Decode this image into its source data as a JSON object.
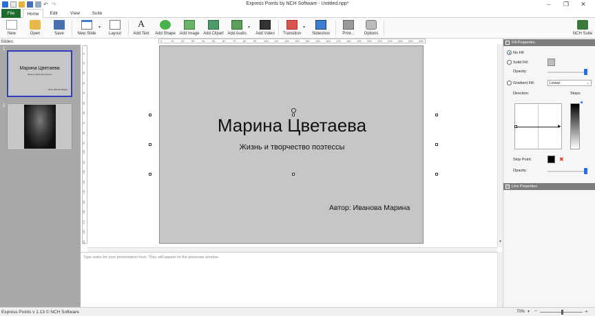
{
  "window": {
    "title": "Express Points by NCH Software - Untitled.npp*"
  },
  "menu_tabs": [
    "File",
    "Home",
    "Edit",
    "View",
    "Suite"
  ],
  "toolbar": {
    "new": "New",
    "open": "Open",
    "save": "Save",
    "new_slide": "New Slide",
    "layout": "Layout",
    "add_text": "Add Text",
    "add_shape": "Add Shape",
    "add_image": "Add Image",
    "add_clipart": "Add Clipart",
    "add_audio": "Add Audio",
    "add_video": "Add Video",
    "transition": "Transition",
    "slideshow": "Slideshov",
    "print": "Print...",
    "options": "Options",
    "nch_suite": "NCH Suite"
  },
  "slides_panel": {
    "label": "Slides:",
    "thumbnails": [
      {
        "number": "1",
        "title": "Марина Цветаева",
        "subtitle": "Жизнь и творчество поэтессы",
        "author": "Автор: Иванова Марина"
      },
      {
        "number": "2"
      }
    ]
  },
  "ruler": {
    "top": [
      "0",
      "10",
      "20",
      "30",
      "40",
      "50",
      "60",
      "70",
      "80",
      "90",
      "100",
      "110",
      "120",
      "130",
      "140",
      "150",
      "160",
      "170",
      "180",
      "190",
      "200",
      "210",
      "220",
      "230",
      "240",
      "250"
    ],
    "left": [
      "0",
      "10",
      "20",
      "30",
      "40",
      "50",
      "60",
      "70",
      "80",
      "90",
      "100",
      "110",
      "120",
      "130",
      "140",
      "150",
      "160",
      "170",
      "180",
      "190"
    ]
  },
  "slide": {
    "title": "Марина Цветаева",
    "subtitle": "Жизнь и творчество поэтессы",
    "author": "Автор: Иванова Марина"
  },
  "notes": {
    "placeholder": "Type notes for your presentation here. They will appear on the presenter window."
  },
  "fill_properties": {
    "header": "Fill Properties",
    "no_fill": "No Fill",
    "solid_fill": "Solid Fill:",
    "opacity": "Opacity:",
    "gradient_fill": "Gradient Fill:",
    "gradient_type": "Linear",
    "direction": "Direction:",
    "stops": "Stops:",
    "stop_point": "Stop Point:",
    "opacity2": "Opacity:"
  },
  "line_properties": {
    "header": "Line Properties"
  },
  "status": {
    "text": "Express Points v 1.13 © NCH Software",
    "zoom": "70%"
  },
  "colors": {
    "file_tab": "#1d6b2e",
    "slide_bg": "#c6c6c6",
    "panel_header": "#7d7d7d",
    "accent": "#2a6fd1"
  }
}
